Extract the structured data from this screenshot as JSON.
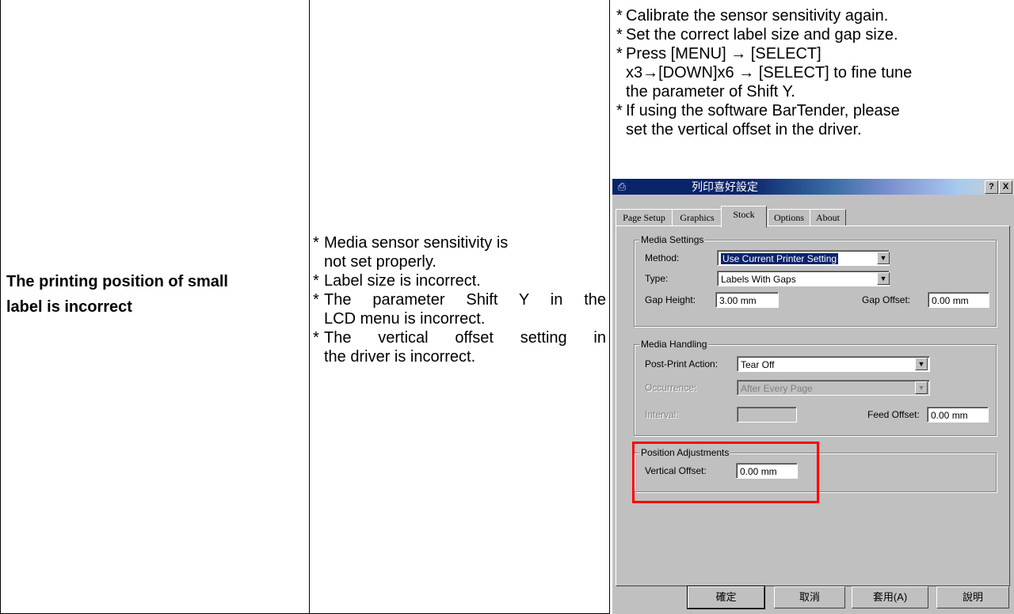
{
  "problem": {
    "line1": "The printing position of small",
    "line2": "label is incorrect"
  },
  "reasons": [
    {
      "line1": "Media sensor sensitivity is",
      "line2": "not set properly."
    },
    {
      "line1": "Label size is incorrect."
    },
    {
      "line1": "The parameter Shift Y in the",
      "line2": "LCD menu is incorrect."
    },
    {
      "line1": "The vertical offset setting in",
      "line2": "the driver is incorrect."
    }
  ],
  "solutions": [
    {
      "line1": "Calibrate the sensor sensitivity again."
    },
    {
      "line1": "Set the correct label size and gap size."
    },
    {
      "line1": "Press [MENU] → [SELECT]",
      "line2": "x3→[DOWN]x6 → [SELECT] to fine tune",
      "line3": "the parameter of Shift Y."
    },
    {
      "line1": "If using the software BarTender, please",
      "line2": "set the vertical offset in the driver."
    }
  ],
  "dialog": {
    "title": "列印喜好設定",
    "help_button": "?",
    "close_button": "X",
    "tabs": [
      "Page Setup",
      "Graphics",
      "Stock",
      "Options",
      "About"
    ],
    "active_tab": "Stock",
    "media_settings": {
      "title": "Media Settings",
      "method_label": "Method:",
      "method_value": "Use Current Printer Setting",
      "type_label": "Type:",
      "type_value": "Labels With Gaps",
      "gap_height_label": "Gap Height:",
      "gap_height_value": "3.00 mm",
      "gap_offset_label": "Gap Offset:",
      "gap_offset_value": "0.00 mm"
    },
    "media_handling": {
      "title": "Media Handling",
      "post_print_label": "Post-Print Action:",
      "post_print_value": "Tear Off",
      "occurrence_label": "Occurrence:",
      "occurrence_value": "After Every Page",
      "interval_label": "Interval:",
      "interval_value": "",
      "feed_offset_label": "Feed Offset:",
      "feed_offset_value": "0.00 mm"
    },
    "position_adjustments": {
      "title": "Position Adjustments",
      "vertical_offset_label": "Vertical Offset:",
      "vertical_offset_value": "0.00 mm"
    },
    "buttons": {
      "ok": "確定",
      "cancel": "取消",
      "apply": "套用(A)",
      "help": "說明"
    }
  },
  "highlight_color": "#ff0000"
}
